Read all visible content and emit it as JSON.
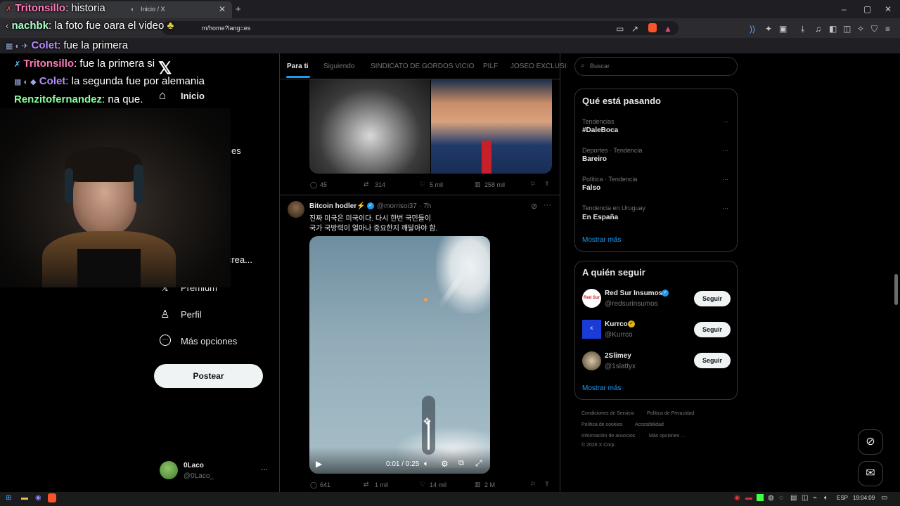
{
  "browser": {
    "tab_title": "Inicio / X",
    "other_tab_title": "Tritonsillo: historia",
    "url": "m/home?lang=es",
    "new_tab": "+"
  },
  "chat": [
    {
      "user": "Tritonsillo",
      "text": ": historia",
      "color": "#ff7ab8"
    },
    {
      "user": "nachbk",
      "text": ": la foto fue oara el video",
      "color": "#b0ffc8"
    },
    {
      "user": "Colet",
      "text": ": fue la primera",
      "color": "#b58cff"
    },
    {
      "user": "Tritonsillo",
      "text": ": fue la primera si",
      "color": "#ff7ab8"
    },
    {
      "user": "Colet",
      "text": ": la segunda fue por alemania",
      "color": "#b58cff"
    },
    {
      "user": "Renzitofernandez",
      "text": ": na que.",
      "color": "#8cff9a"
    }
  ],
  "nav": {
    "home": "Inicio",
    "partial_es": "es",
    "partial_crea": "n crea...",
    "premium": "Premium",
    "profile": "Perfil",
    "more": "Más opciones",
    "post": "Postear",
    "account_name": "0Laco",
    "account_handle": "@0Laco_",
    "more_dots": "···"
  },
  "feed": {
    "tabs": [
      "Para ti",
      "Siguiendo",
      "SINDICATO DE GORDOS VICIO",
      "PILF",
      "JOSEO EXCLUSI"
    ],
    "tweet1_actions": {
      "replies": "45",
      "reposts": "314",
      "likes": "5 mil",
      "views": "258 mil"
    },
    "tweet2": {
      "name": "Bitcoin hodler⚡",
      "handle": "@morrisoi37",
      "time": "· 7h",
      "text_line1": "진짜 미국은 미국이다. 다시 한번 국민들이",
      "text_line2": "국가 국방력이 얼마나 중요한지 깨달아야 함.",
      "video_time": "0:01 / 0:25",
      "actions": {
        "replies": "641",
        "reposts": "1 mil",
        "likes": "14 mil",
        "views": "2 M"
      }
    }
  },
  "right": {
    "search_placeholder": "Buscar",
    "trends_title": "Qué está pasando",
    "trends": [
      {
        "context": "Tendencias",
        "name": "#DaleBoca"
      },
      {
        "context": "Deportes · Tendencia",
        "name": "Bareiro"
      },
      {
        "context": "Política · Tendencia",
        "name": "Falso"
      },
      {
        "context": "Tendencia en Uruguay",
        "name": "En España"
      }
    ],
    "show_more": "Mostrar más",
    "follow_title": "A quién seguir",
    "follow": [
      {
        "name": "Red Sur Insumos",
        "handle": "@redsurinsumos",
        "button": "Seguir"
      },
      {
        "name": "Kurrco",
        "handle": "@Kurrco",
        "button": "Seguir"
      },
      {
        "name": "2Slimey",
        "handle": "@1slattyx",
        "button": "Seguir"
      }
    ],
    "show_more2": "Mostrar más",
    "footer": [
      "Condiciones de Servicio",
      "Política de Privacidad",
      "Política de cookies",
      "Accesibilidad",
      "Información de anuncios",
      "Más opciones ...",
      "© 2026 X Corp."
    ]
  },
  "taskbar": {
    "lang": "ESP",
    "clock": "19:04:09"
  },
  "colors": {
    "accent": "#1d9bf0",
    "verified": "#1d9bf0",
    "gold": "#e2b719"
  }
}
